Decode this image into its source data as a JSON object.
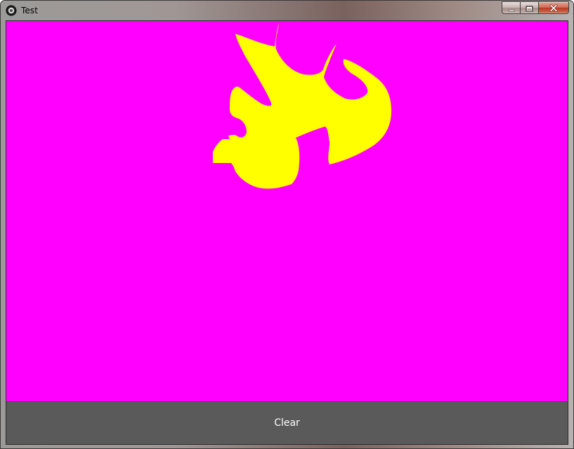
{
  "window": {
    "title": "Test",
    "controls": {
      "minimize_icon": "minimize-icon",
      "maximize_icon": "maximize-icon",
      "close_icon": "close-icon"
    }
  },
  "canvas": {
    "background_color": "#ff00ff",
    "stroke_color": "#ffff00"
  },
  "toolbar": {
    "clear_label": "Clear",
    "background_color": "#5a5a5a"
  }
}
